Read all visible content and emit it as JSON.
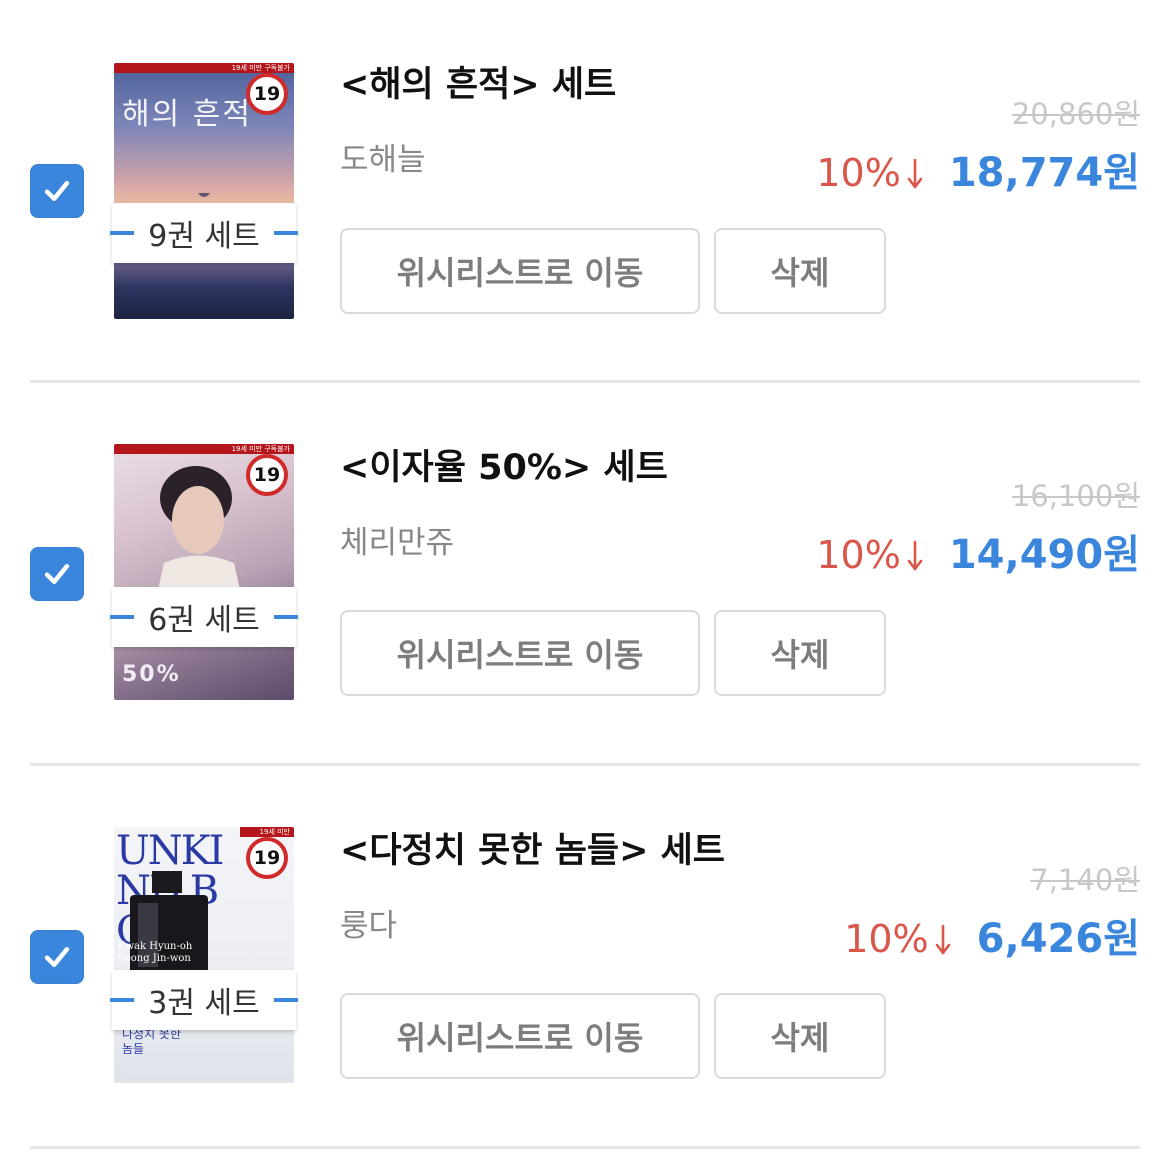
{
  "items": [
    {
      "title": "<해의 흔적> 세트",
      "author": "도해늘",
      "set_label": "9권 세트",
      "original_price": "20,860원",
      "discount": "10%",
      "sale_price": "18,774원",
      "age_badge": "19",
      "cover_title": "해의 흔적",
      "wishlist_button": "위시리스트로 이동",
      "delete_button": "삭제",
      "checked": true
    },
    {
      "title": "<이자율 50%> 세트",
      "author": "체리만쥬",
      "set_label": "6권 세트",
      "original_price": "16,100원",
      "discount": "10%",
      "sale_price": "14,490원",
      "age_badge": "19",
      "cover_title": "50%",
      "wishlist_button": "위시리스트로 이동",
      "delete_button": "삭제",
      "checked": true
    },
    {
      "title": "<다정치 못한 놈들> 세트",
      "author": "룽다",
      "set_label": "3권 세트",
      "original_price": "7,140원",
      "discount": "10%",
      "sale_price": "6,426원",
      "age_badge": "19",
      "cover_title": "UNKIND BOYS",
      "cover_names": "Kwak Hyun-oh\nSeong Jin-won",
      "cover_subtitle": "다정치 못한 놈들",
      "wishlist_button": "위시리스트로 이동",
      "delete_button": "삭제",
      "checked": true
    }
  ],
  "colors": {
    "accent_blue": "#3b86dd",
    "discount_red": "#d9574a",
    "badge_red": "#d12a2a",
    "muted_text": "#888888",
    "strike_price": "#c8c8c8"
  },
  "icons": {
    "checkbox": "check-icon",
    "discount": "down-arrow-icon"
  }
}
